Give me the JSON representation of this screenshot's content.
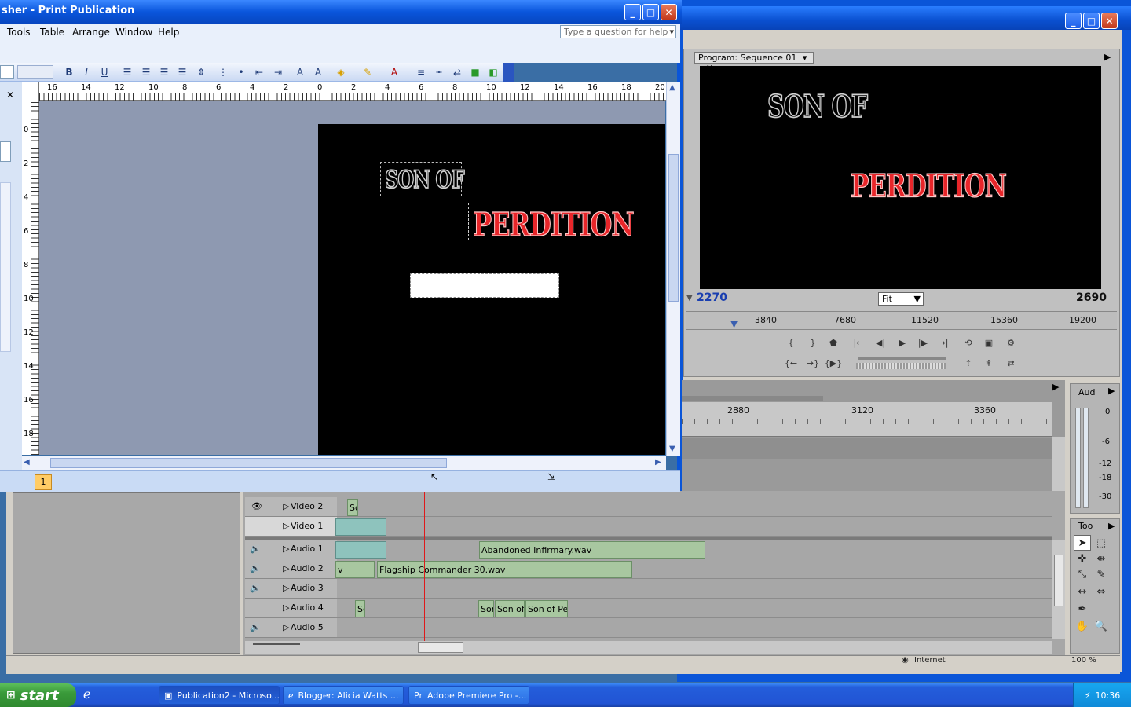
{
  "premiere": {
    "program_tab": "Program: Sequence 01",
    "title_line1": "SON OF",
    "title_line2": "PERDITION",
    "timecode_in": "2270",
    "timecode_out": "2690",
    "zoom": "Fit",
    "ruler_ticks": [
      "3840",
      "7680",
      "11520",
      "15360",
      "19200"
    ],
    "timeline_ticks": [
      "2880",
      "3120",
      "3360"
    ],
    "tracks": [
      {
        "name": "Video 2"
      },
      {
        "name": "Video 1"
      },
      {
        "name": "Audio 1"
      },
      {
        "name": "Audio 2"
      },
      {
        "name": "Audio 3"
      },
      {
        "name": "Audio 4"
      },
      {
        "name": "Audio 5"
      }
    ],
    "clips": {
      "video2_clip": "Sc",
      "audio1_clip": "Abandoned Infirmary.wav",
      "audio2_prefix": "v",
      "audio2_clip": "Flagship Commander 30.wav",
      "audio4_c1": "Sc",
      "audio4_c2": "Sor",
      "audio4_c3": "Son of",
      "audio4_c4": "Son of Per"
    },
    "audio_master_tab": "Aud",
    "audio_scale": [
      "0",
      "-6",
      "-12",
      "-18",
      "-30"
    ],
    "tools_tab": "Too",
    "status_text": "Internet",
    "status_zoom": "100 %"
  },
  "publisher": {
    "title": "sher - Print Publication",
    "menu": [
      "Tools",
      "Table",
      "Arrange",
      "Window",
      "Help"
    ],
    "help_placeholder": "Type a question for help",
    "hruler": [
      "16",
      "14",
      "12",
      "10",
      "8",
      "6",
      "4",
      "2",
      "0",
      "2",
      "4",
      "6",
      "8",
      "10",
      "12",
      "14",
      "16",
      "18",
      "20"
    ],
    "vruler": [
      "0",
      "2",
      "4",
      "6",
      "8",
      "10",
      "12",
      "14",
      "16",
      "18"
    ],
    "page_number": "1",
    "title_line1": "SON OF",
    "title_line2": "PERDITION"
  },
  "taskbar": {
    "start": "start",
    "tasks": [
      "Publication2 - Microso...",
      "Blogger: Alicia Watts ...",
      "Adobe Premiere Pro -..."
    ],
    "clock": "10:36"
  },
  "colors": {
    "xp_blue": "#0a55d8",
    "title_red": "#e8262a",
    "timecode_blue": "#1a3fb0",
    "playhead": "#e0181a"
  }
}
